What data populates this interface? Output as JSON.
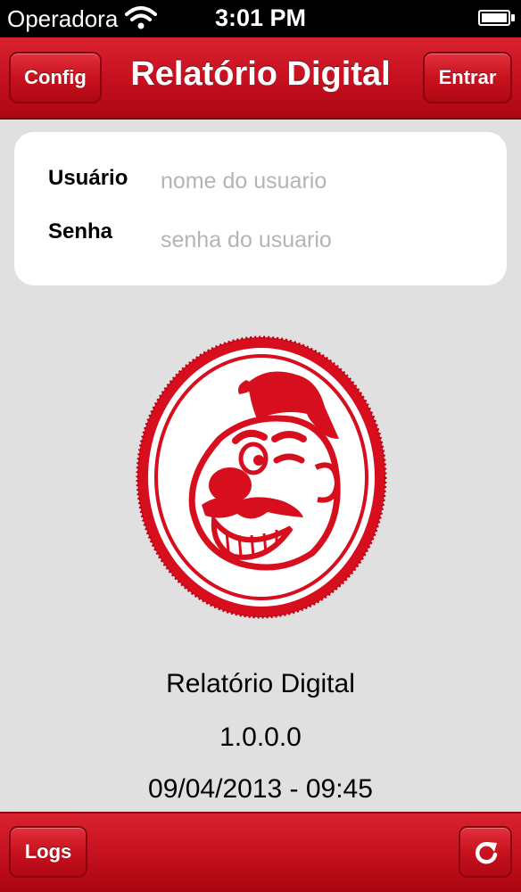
{
  "status_bar": {
    "carrier": "Operadora",
    "time": "3:01 PM"
  },
  "nav_bar": {
    "title": "Relatório Digital",
    "left_button": "Config",
    "right_button": "Entrar"
  },
  "login_form": {
    "user_label": "Usuário",
    "user_placeholder": "nome do usuario",
    "password_label": "Senha",
    "password_placeholder": "senha do usuario"
  },
  "info": {
    "app_name": "Relatório Digital",
    "version": "1.0.0.0",
    "date": "09/04/2013 - 09:45"
  },
  "toolbar": {
    "logs_button": "Logs",
    "refresh_icon": "refresh-icon"
  },
  "colors": {
    "brand_red": "#c71120",
    "background": "#e0e0e0"
  }
}
